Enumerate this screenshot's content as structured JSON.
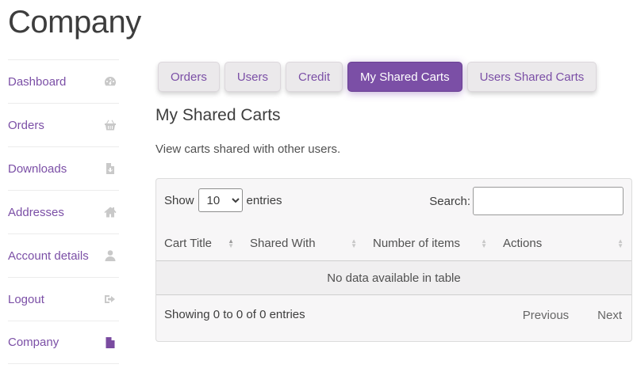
{
  "page": {
    "title": "Company"
  },
  "sidebar": {
    "items": [
      {
        "label": "Dashboard",
        "icon": "tachometer-icon"
      },
      {
        "label": "Orders",
        "icon": "basket-icon"
      },
      {
        "label": "Downloads",
        "icon": "file-download-icon"
      },
      {
        "label": "Addresses",
        "icon": "home-icon"
      },
      {
        "label": "Account details",
        "icon": "user-icon"
      },
      {
        "label": "Logout",
        "icon": "sign-out-icon"
      },
      {
        "label": "Company",
        "icon": "file-text-icon",
        "active": true
      }
    ]
  },
  "tabs": [
    {
      "label": "Orders"
    },
    {
      "label": "Users"
    },
    {
      "label": "Credit"
    },
    {
      "label": "My Shared Carts",
      "active": true
    },
    {
      "label": "Users Shared Carts"
    }
  ],
  "section": {
    "title": "My Shared Carts",
    "description": "View carts shared with other users."
  },
  "table": {
    "length_prefix": "Show",
    "length_suffix": "entries",
    "length_selected": "10",
    "search_label": "Search:",
    "search_value": "",
    "columns": [
      "Cart Title",
      "Shared With",
      "Number of items",
      "Actions"
    ],
    "empty_message": "No data available in table",
    "info": "Showing 0 to 0 of 0 entries",
    "prev_label": "Previous",
    "next_label": "Next"
  },
  "colors": {
    "accent": "#7b4fa6",
    "tab_bg": "#ebe9eb",
    "panel_bg": "#f7f6f7"
  }
}
